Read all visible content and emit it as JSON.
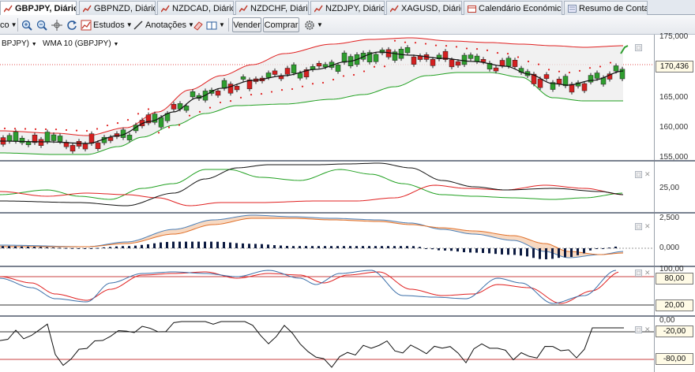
{
  "tabs": [
    {
      "label": "GBPJPY, Diário",
      "active": true,
      "close": "×"
    },
    {
      "label": "GBPNZD, Diário",
      "active": false
    },
    {
      "label": "NZDCAD, Diário",
      "active": false
    },
    {
      "label": "NZDCHF, Diário",
      "active": false
    },
    {
      "label": "NZDJPY, Diário",
      "active": false
    },
    {
      "label": "XAGUSD, Diário",
      "active": false
    },
    {
      "label": "Calendário Económico",
      "active": false
    },
    {
      "label": "Resumo de Conta",
      "active": false
    }
  ],
  "toolbar": {
    "chart_type_label": "co",
    "studies_label": "Estudos",
    "annotations_label": "Anotações",
    "sell_label": "Vender",
    "buy_label": "Comprar"
  },
  "legend": {
    "symbol": "BPJPY)",
    "wma": "WMA 10 (GBPJPY)"
  },
  "price_axis": {
    "ticks": [
      "175,000",
      "165,000",
      "160,000",
      "155,000"
    ],
    "current_price": "170,436"
  },
  "adx_axis": {
    "ticks": [
      "25,00"
    ]
  },
  "macd_axis": {
    "ticks": [
      "2,500",
      "0,000"
    ]
  },
  "stoch_axis": {
    "ticks": [
      "100,00",
      "80,00",
      "20,00"
    ]
  },
  "williams_axis": {
    "ticks": [
      "0,00",
      "-20,00",
      "-80,00"
    ]
  },
  "colors": {
    "bull_candle": "#2e9e2e",
    "bear_candle": "#d42020",
    "upper_band": "#e02020",
    "lower_band": "#20a020",
    "wma": "#111111",
    "sar": "#e02020",
    "panel_divider": "#7a8290"
  },
  "icons": {
    "zoom_in": "magnifier-plus-icon",
    "zoom_out": "magnifier-minus-icon",
    "studies": "studies-icon",
    "annotations": "pencil-icon",
    "trend": "trend-arrow-icon"
  }
}
